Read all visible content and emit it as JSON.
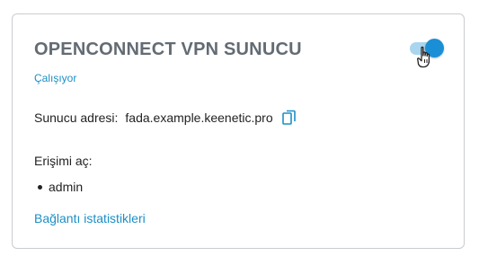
{
  "card": {
    "title": "OPENCONNECT VPN SUNUCU",
    "status": "Çalışıyor",
    "toggle": {
      "state": "on",
      "track_color": "#a9d5ef",
      "knob_color": "#1a8fd6"
    },
    "server": {
      "label": "Sunucu adresi:",
      "value": "fada.example.keenetic.pro",
      "copy_icon": "copy-icon"
    },
    "access": {
      "label": "Erişimi aç:",
      "users": [
        "admin"
      ]
    },
    "stats_link": "Bağlantı istatistikleri"
  },
  "colors": {
    "accent": "#1b8fc6",
    "title": "#636b73",
    "text": "#222222",
    "border": "#c9ccd0"
  },
  "cursor": {
    "type": "hand-pointer-icon"
  }
}
